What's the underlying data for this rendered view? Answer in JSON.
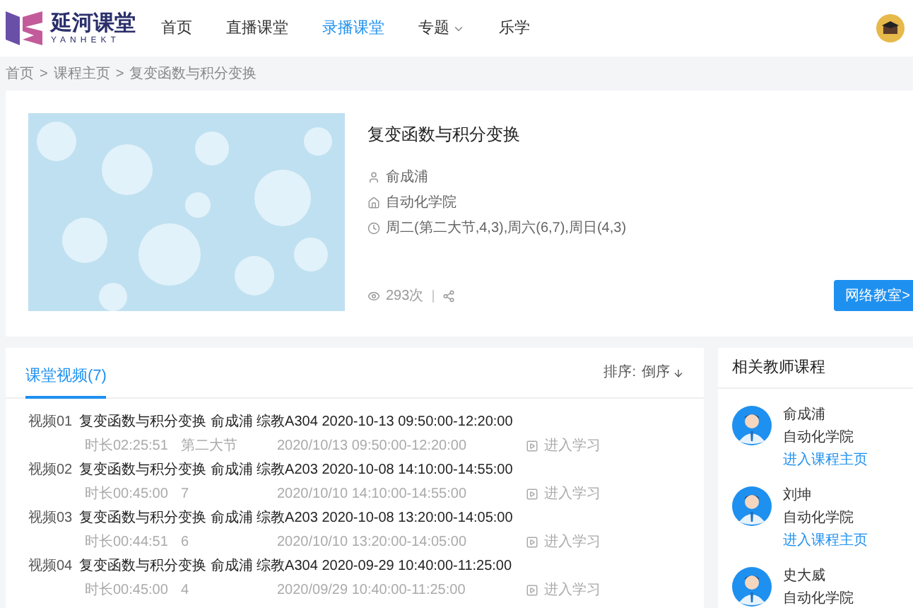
{
  "header": {
    "logo_text": "延河课堂",
    "logo_subtext": "YANHEKT",
    "nav": [
      {
        "label": "首页",
        "selected": false,
        "dropdown": false
      },
      {
        "label": "直播课堂",
        "selected": false,
        "dropdown": false
      },
      {
        "label": "录播课堂",
        "selected": true,
        "dropdown": false
      },
      {
        "label": "专题",
        "selected": false,
        "dropdown": true
      },
      {
        "label": "乐学",
        "selected": false,
        "dropdown": false
      }
    ]
  },
  "breadcrumb": [
    {
      "label": "首页"
    },
    {
      "separator": ">",
      "label": "课程主页"
    },
    {
      "separator": ">",
      "label": "复变函数与积分变换"
    }
  ],
  "course": {
    "title": "复变函数与积分变换",
    "teacher": "俞成浦",
    "college": "自动化学院",
    "schedule": "周二(第二大节,4,3),周六(6,7),周日(4,3)",
    "views": "293次",
    "button": "网络教室>"
  },
  "videos": {
    "tab": "课堂视频(7)",
    "sort_label": "排序:",
    "sort_value": "倒序",
    "rows": [
      {
        "index": "视频01",
        "title": "复变函数与积分变换 俞成浦 综教A304 2020-10-13 09:50:00-12:20:00",
        "duration": "时长02:25:51",
        "section": "第二大节",
        "time": "2020/10/13 09:50:00-12:20:00",
        "action": "进入学习"
      },
      {
        "index": "视频02",
        "title": "复变函数与积分变换 俞成浦 综教A203 2020-10-08 14:10:00-14:55:00",
        "duration": "时长00:45:00",
        "section": "7",
        "time": "2020/10/10 14:10:00-14:55:00",
        "action": "进入学习"
      },
      {
        "index": "视频03",
        "title": "复变函数与积分变换 俞成浦 综教A203 2020-10-08 13:20:00-14:05:00",
        "duration": "时长00:44:51",
        "section": "6",
        "time": "2020/10/10 13:20:00-14:05:00",
        "action": "进入学习"
      },
      {
        "index": "视频04",
        "title": "复变函数与积分变换 俞成浦 综教A304 2020-09-29 10:40:00-11:25:00",
        "duration": "时长00:45:00",
        "section": "4",
        "time": "2020/09/29 10:40:00-11:25:00",
        "action": "进入学习"
      }
    ]
  },
  "related": {
    "title": "相关教师课程",
    "teachers": [
      {
        "name": "俞成浦",
        "college": "自动化学院",
        "link": "进入课程主页"
      },
      {
        "name": "刘坤",
        "college": "自动化学院",
        "link": "进入课程主页"
      },
      {
        "name": "史大威",
        "college": "自动化学院"
      }
    ]
  }
}
